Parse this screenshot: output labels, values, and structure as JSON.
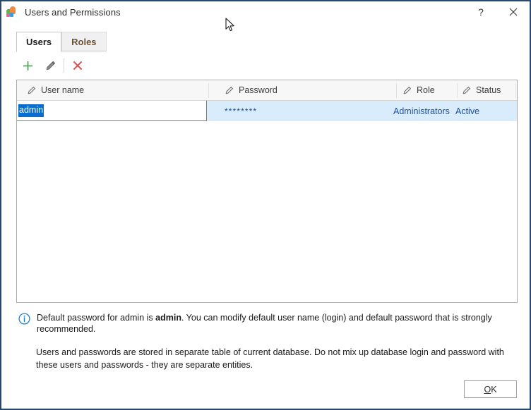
{
  "window": {
    "title": "Users and Permissions",
    "icon": "app-leaf-icon",
    "help_button": "?",
    "close_button": "✕",
    "border_color": "#27496d"
  },
  "tabs": [
    {
      "label": "Users",
      "active": true
    },
    {
      "label": "Roles",
      "active": false
    }
  ],
  "toolbar": {
    "add": {
      "name": "add-user-button",
      "glyph": "+",
      "color": "#4caf50"
    },
    "edit": {
      "name": "edit-user-button",
      "glyph": "✎",
      "color": "#5a5a5a"
    },
    "delete": {
      "name": "delete-user-button",
      "glyph": "✕",
      "color": "#e04b4b"
    }
  },
  "grid": {
    "columns": [
      {
        "label": "User name",
        "icon": "pencil-icon"
      },
      {
        "label": "Password",
        "icon": "pencil-icon"
      },
      {
        "label": "Role",
        "icon": "pencil-icon"
      },
      {
        "label": "Status",
        "icon": "pencil-icon"
      }
    ],
    "rows": [
      {
        "user_name": "admin",
        "password": "********",
        "role": "Administrators",
        "status": "Active",
        "selected": true,
        "editing_cell": "user_name"
      }
    ],
    "selection_color": "#0a6ed1",
    "row_highlight_color": "#d9ecfb"
  },
  "info": {
    "icon": "info-circle-icon",
    "line1_before": "Default password for admin is ",
    "line1_bold": "admin",
    "line1_after": ". You can modify default user name (login) and default password that is strongly recommended.",
    "line2": "Users and passwords are stored in separate table of current database. Do not mix up database login and password with these users and passwords - they are separate entities."
  },
  "footer": {
    "ok_accel": "O",
    "ok_rest": "K"
  }
}
